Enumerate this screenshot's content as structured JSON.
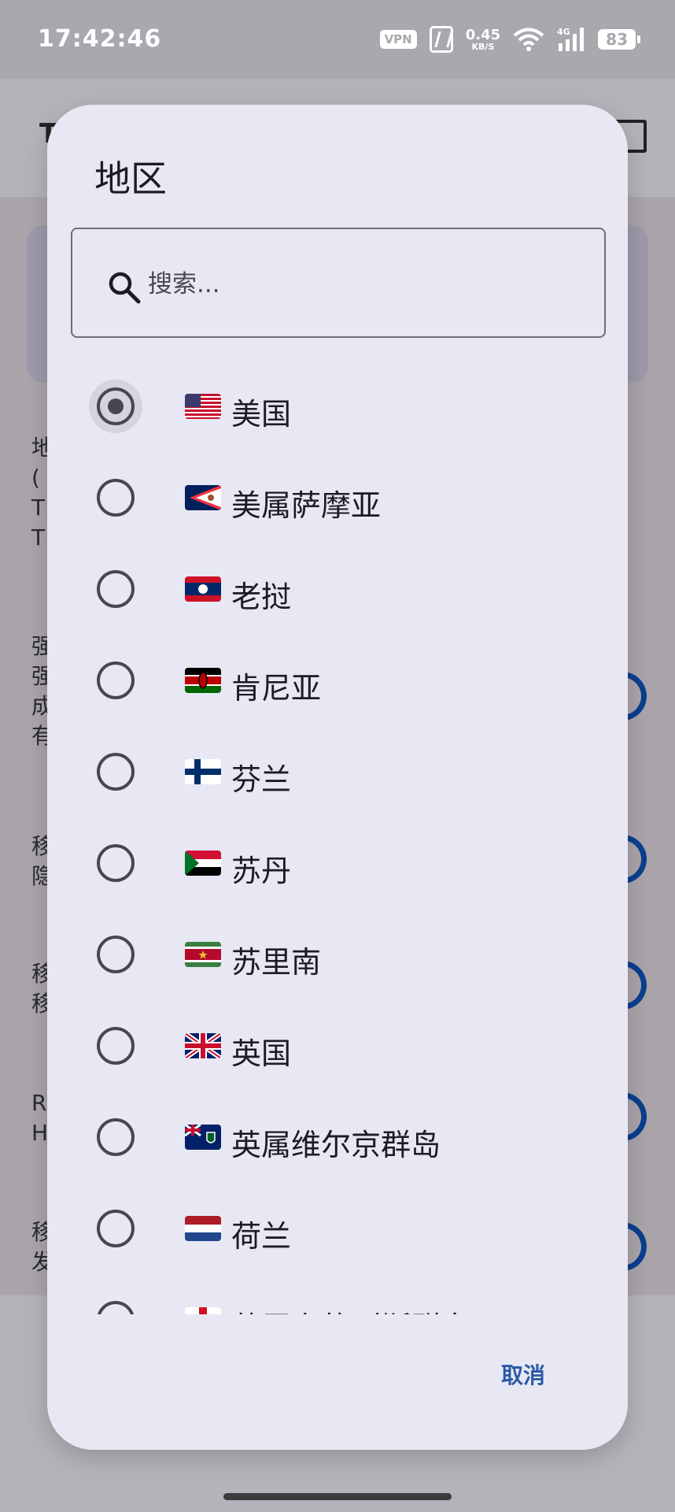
{
  "status_bar": {
    "time": "17:42:46",
    "vpn": "VPN",
    "net_speed_value": "0.45",
    "net_speed_unit": "KB/S",
    "network_type": "4G",
    "battery": "83"
  },
  "background": {
    "header_letter": "T",
    "rows": [
      {
        "title": "地",
        "lines": [
          "(",
          "T",
          "T"
        ]
      },
      {
        "title": "强",
        "lines": [
          "强",
          "成",
          "有"
        ]
      },
      {
        "title": "移",
        "lines": [
          "隐"
        ]
      },
      {
        "title": "移",
        "lines": [
          "移"
        ]
      },
      {
        "title": "R",
        "lines": [
          "H"
        ]
      },
      {
        "title": "移",
        "lines": [
          "发"
        ]
      }
    ]
  },
  "dialog": {
    "title": "地区",
    "search_placeholder": "搜索...",
    "cancel_label": "取消",
    "items": [
      {
        "label": "美国",
        "flag": "us",
        "selected": true
      },
      {
        "label": "美属萨摩亚",
        "flag": "as",
        "selected": false
      },
      {
        "label": "老挝",
        "flag": "la",
        "selected": false
      },
      {
        "label": "肯尼亚",
        "flag": "ke",
        "selected": false
      },
      {
        "label": "芬兰",
        "flag": "fi",
        "selected": false
      },
      {
        "label": "苏丹",
        "flag": "sd",
        "selected": false
      },
      {
        "label": "苏里南",
        "flag": "sr",
        "selected": false
      },
      {
        "label": "英国",
        "flag": "gb",
        "selected": false
      },
      {
        "label": "英属维尔京群岛",
        "flag": "vg",
        "selected": false
      },
      {
        "label": "荷兰",
        "flag": "nl",
        "selected": false
      },
      {
        "label": "英属安的列斯群岛",
        "flag": "an",
        "selected": false
      }
    ]
  },
  "colors": {
    "dialog_bg": "#e8e8f4",
    "accent": "#2b5aa8",
    "radio": "#48474f",
    "toggle": "#0b3f8f"
  }
}
